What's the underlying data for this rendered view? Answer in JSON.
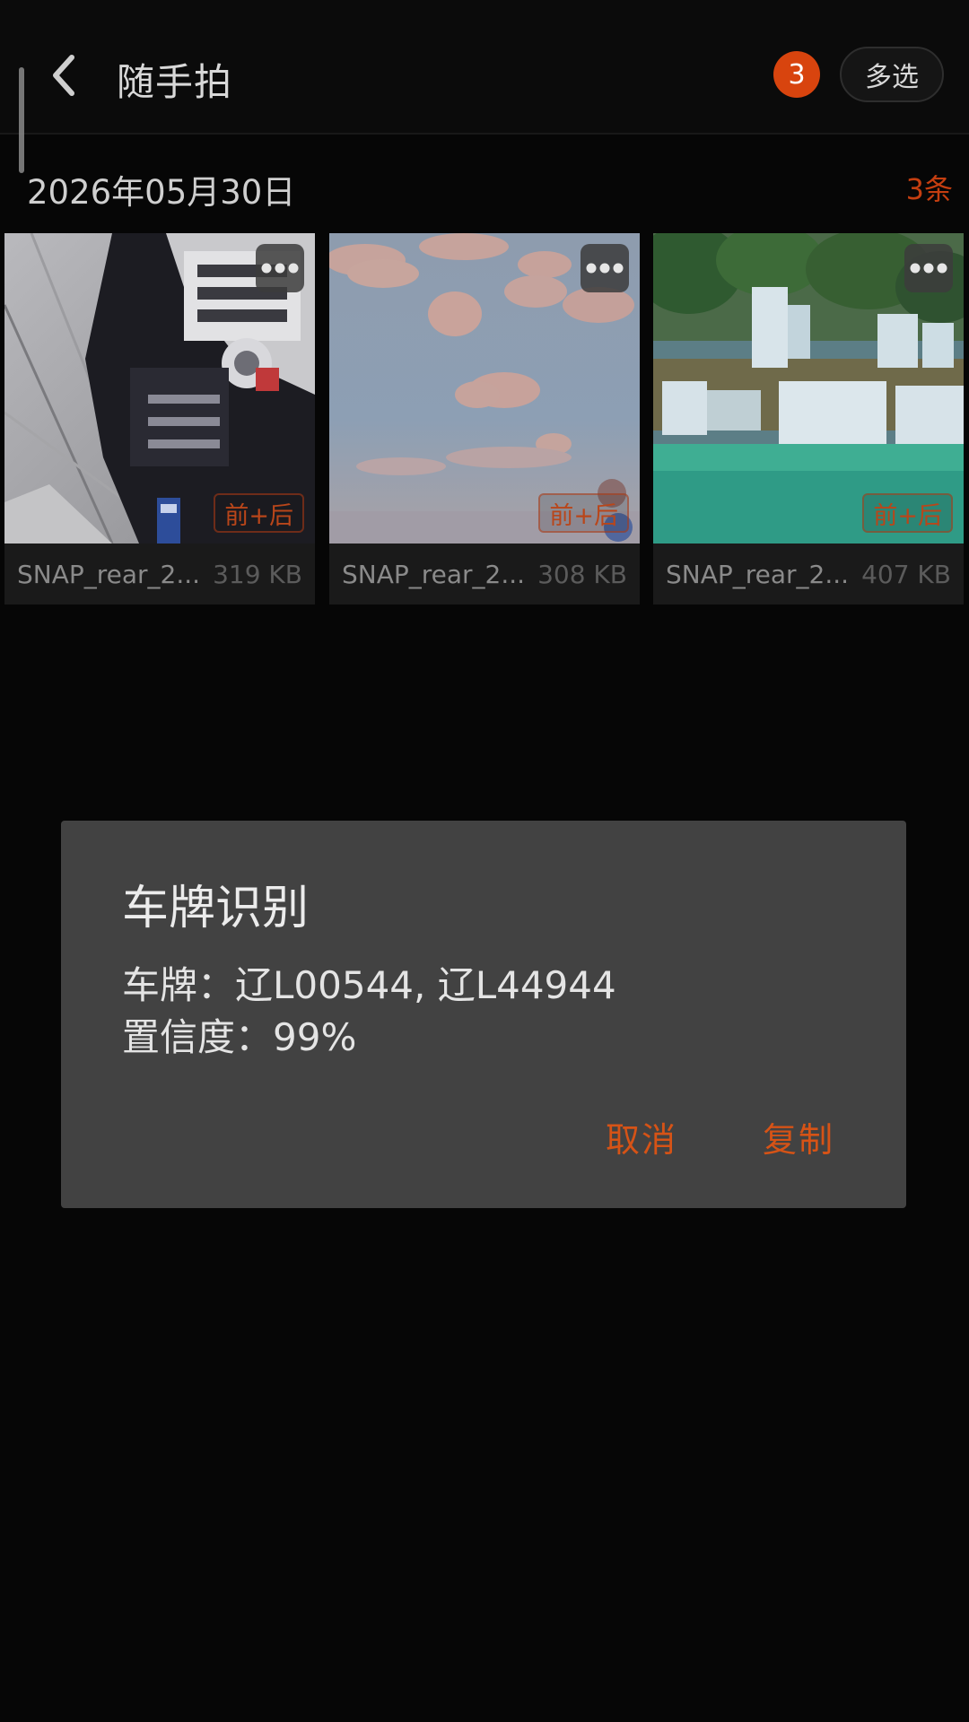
{
  "header": {
    "title": "随手拍",
    "badge_count": "3",
    "multi_select_label": "多选",
    "back_icon": "chevron-left-icon"
  },
  "section": {
    "date": "2026年05月30日",
    "count_label": "3条"
  },
  "items": [
    {
      "file_name": "SNAP_rear_2...",
      "file_size": "319 KB",
      "tag": "前+后",
      "thumbnail": "car-front-photo"
    },
    {
      "file_name": "SNAP_rear_2...",
      "file_size": "308 KB",
      "tag": "前+后",
      "thumbnail": "sky-clouds-photo"
    },
    {
      "file_name": "SNAP_rear_2...",
      "file_size": "407 KB",
      "tag": "前+后",
      "thumbnail": "waterfall-photo"
    }
  ],
  "dialog": {
    "title": "车牌识别",
    "plate_line": "车牌：辽L00544, 辽L44944",
    "confidence_line": "置信度：99%",
    "cancel_label": "取消",
    "copy_label": "复制"
  },
  "colors": {
    "accent": "#d65316",
    "badge": "#d8440e",
    "dialog_bg": "#424242",
    "background": "#060606"
  }
}
